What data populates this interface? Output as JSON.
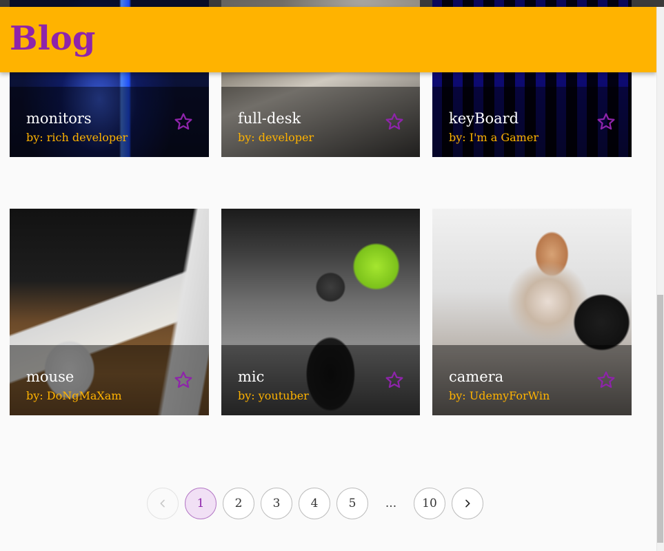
{
  "header": {
    "brand": "Blog",
    "background": "#ffb300",
    "brand_color": "#8e24aa"
  },
  "cards": [
    {
      "title": "monitors",
      "author": "by: rich developer",
      "image": "monitors-image",
      "favorite_icon": "star-outline-icon"
    },
    {
      "title": "full-desk",
      "author": "by: developer",
      "image": "desk-image",
      "favorite_icon": "star-outline-icon"
    },
    {
      "title": "keyBoard",
      "author": "by: I'm a Gamer",
      "image": "keyboard-image",
      "favorite_icon": "star-outline-icon"
    },
    {
      "title": "mouse",
      "author": "by: DoNgMaXam",
      "image": "mouse-image",
      "favorite_icon": "star-outline-icon"
    },
    {
      "title": "mic",
      "author": "by: youtuber",
      "image": "microphone-image",
      "favorite_icon": "star-outline-icon"
    },
    {
      "title": "camera",
      "author": "by: UdemyForWin",
      "image": "camera-image",
      "favorite_icon": "star-outline-icon"
    }
  ],
  "pagination": {
    "prev_icon": "chevron-left-icon",
    "next_icon": "chevron-right-icon",
    "pages": [
      "1",
      "2",
      "3",
      "4",
      "5"
    ],
    "ellipsis": "...",
    "last_page": "10",
    "current": "1"
  },
  "colors": {
    "accent": "#8e24aa",
    "author_text": "#ffb300",
    "title_text": "#ffffff"
  }
}
